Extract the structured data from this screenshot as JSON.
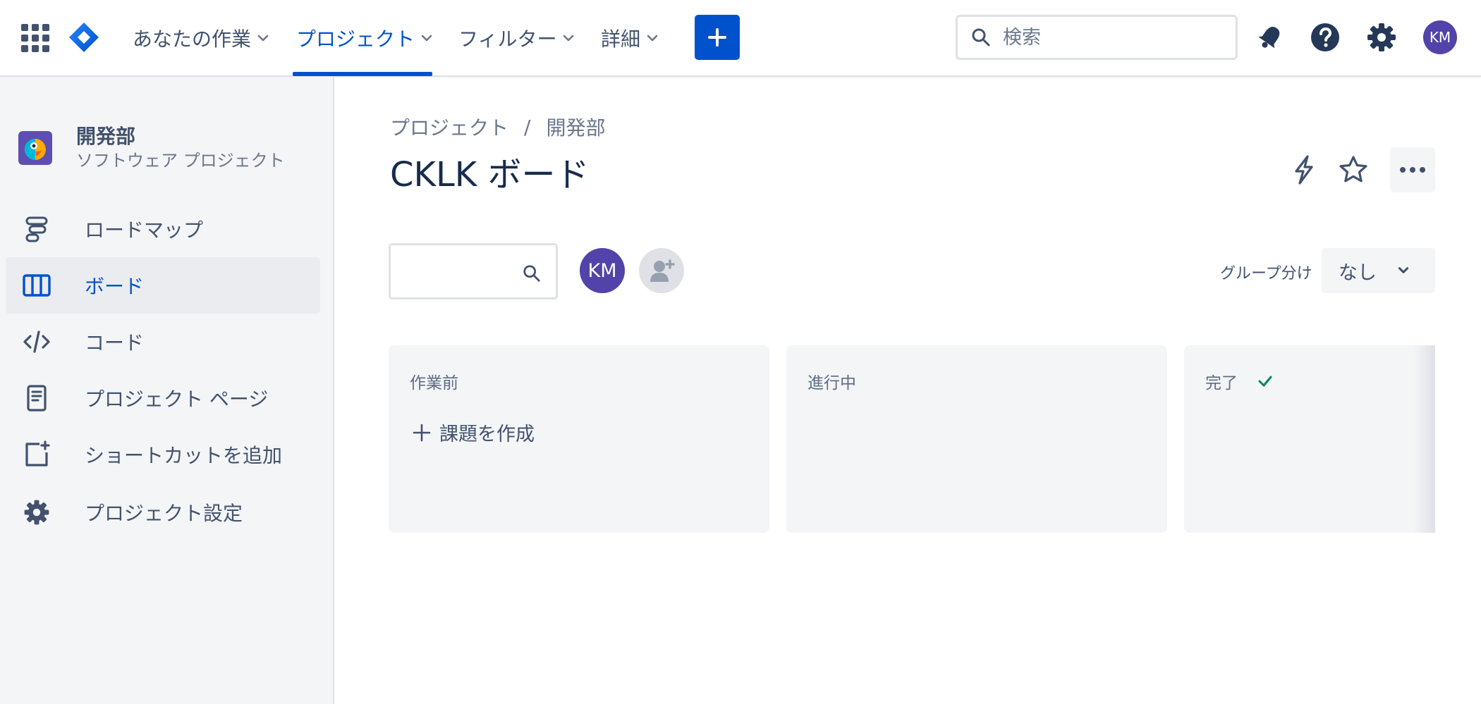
{
  "colors": {
    "brand": "#0052cc",
    "text_primary": "#172b4d",
    "text_secondary": "#42526e",
    "sidebar_bg": "#f4f5f7",
    "avatar": "#5243aa",
    "success": "#00875a"
  },
  "topnav": {
    "app_switcher_icon": "app-grid-icon",
    "logo_icon": "jira-logo-icon",
    "items": [
      {
        "label": "あなたの作業"
      },
      {
        "label": "プロジェクト"
      },
      {
        "label": "フィルター"
      },
      {
        "label": "詳細"
      }
    ],
    "active_index": 1,
    "create_icon": "plus-icon",
    "search": {
      "placeholder": "検索",
      "value": ""
    },
    "notifications_icon": "bell-icon",
    "help_icon": "help-icon",
    "settings_icon": "gear-icon",
    "user_initials": "KM"
  },
  "sidebar": {
    "project_name": "開発部",
    "project_type": "ソフトウェア プロジェクト",
    "items": [
      {
        "label": "ロードマップ",
        "icon": "roadmap-icon"
      },
      {
        "label": "ボード",
        "icon": "board-icon"
      },
      {
        "label": "コード",
        "icon": "code-icon"
      },
      {
        "label": "プロジェクト ページ",
        "icon": "page-icon"
      },
      {
        "label": "ショートカットを追加",
        "icon": "add-shortcut-icon"
      },
      {
        "label": "プロジェクト設定",
        "icon": "gear-icon"
      }
    ],
    "active_index": 1
  },
  "main": {
    "breadcrumb": [
      "プロジェクト",
      "開発部"
    ],
    "breadcrumb_separator": "/",
    "title": "CKLK ボード",
    "filter_search": {
      "placeholder": "",
      "value": ""
    },
    "assignee_initials": "KM",
    "group_by": {
      "label": "グループ分け",
      "value": "なし"
    },
    "columns": [
      {
        "title": "作業前",
        "create_label": "課題を作成"
      },
      {
        "title": "進行中"
      },
      {
        "title": "完了",
        "done_icon": "check-icon"
      }
    ]
  }
}
